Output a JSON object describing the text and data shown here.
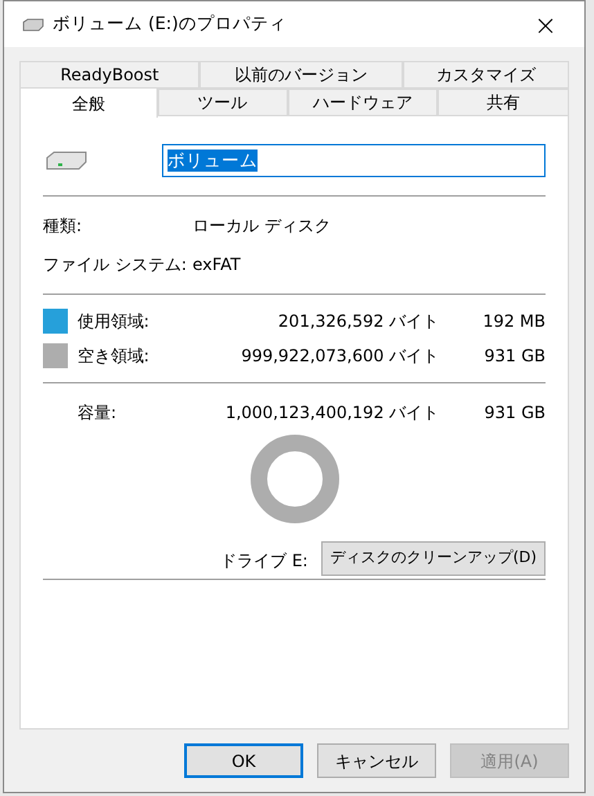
{
  "window": {
    "title": "ボリューム (E:)のプロパティ",
    "close": "×"
  },
  "tab_rows": [
    [
      {
        "label": "ReadyBoost",
        "selected": false
      },
      {
        "label": "以前のバージョン",
        "selected": false
      },
      {
        "label": "カスタマイズ",
        "selected": false
      }
    ],
    [
      {
        "label": "全般",
        "selected": true
      },
      {
        "label": "ツール",
        "selected": false
      },
      {
        "label": "ハードウェア",
        "selected": false
      },
      {
        "label": "共有",
        "selected": false
      }
    ]
  ],
  "name_field": {
    "value": "ボリューム"
  },
  "info": [
    {
      "label": "種類:",
      "value": "ローカル ディスク"
    },
    {
      "label": "ファイル システム:",
      "value": "exFAT"
    }
  ],
  "usage": [
    {
      "label": "使用領域:",
      "bytes": "201,326,592 バイト",
      "size": "192 MB",
      "color": "#26a0da"
    },
    {
      "label": "空き領域:",
      "bytes": "999,922,073,600 バイト",
      "size": "931 GB",
      "color": "#adadad"
    }
  ],
  "capacity": {
    "label": "容量:",
    "bytes": "1,000,123,400,192 バイト",
    "size": "931 GB"
  },
  "drive_label": "ドライブ E:",
  "cleanup_button": "ディスクのクリーンアップ(D)",
  "buttons": [
    {
      "label": "OK",
      "kind": "default",
      "disabled": false
    },
    {
      "label": "キャンセル",
      "kind": "normal",
      "disabled": false
    },
    {
      "label": "適用(A)",
      "kind": "normal",
      "disabled": true
    }
  ]
}
